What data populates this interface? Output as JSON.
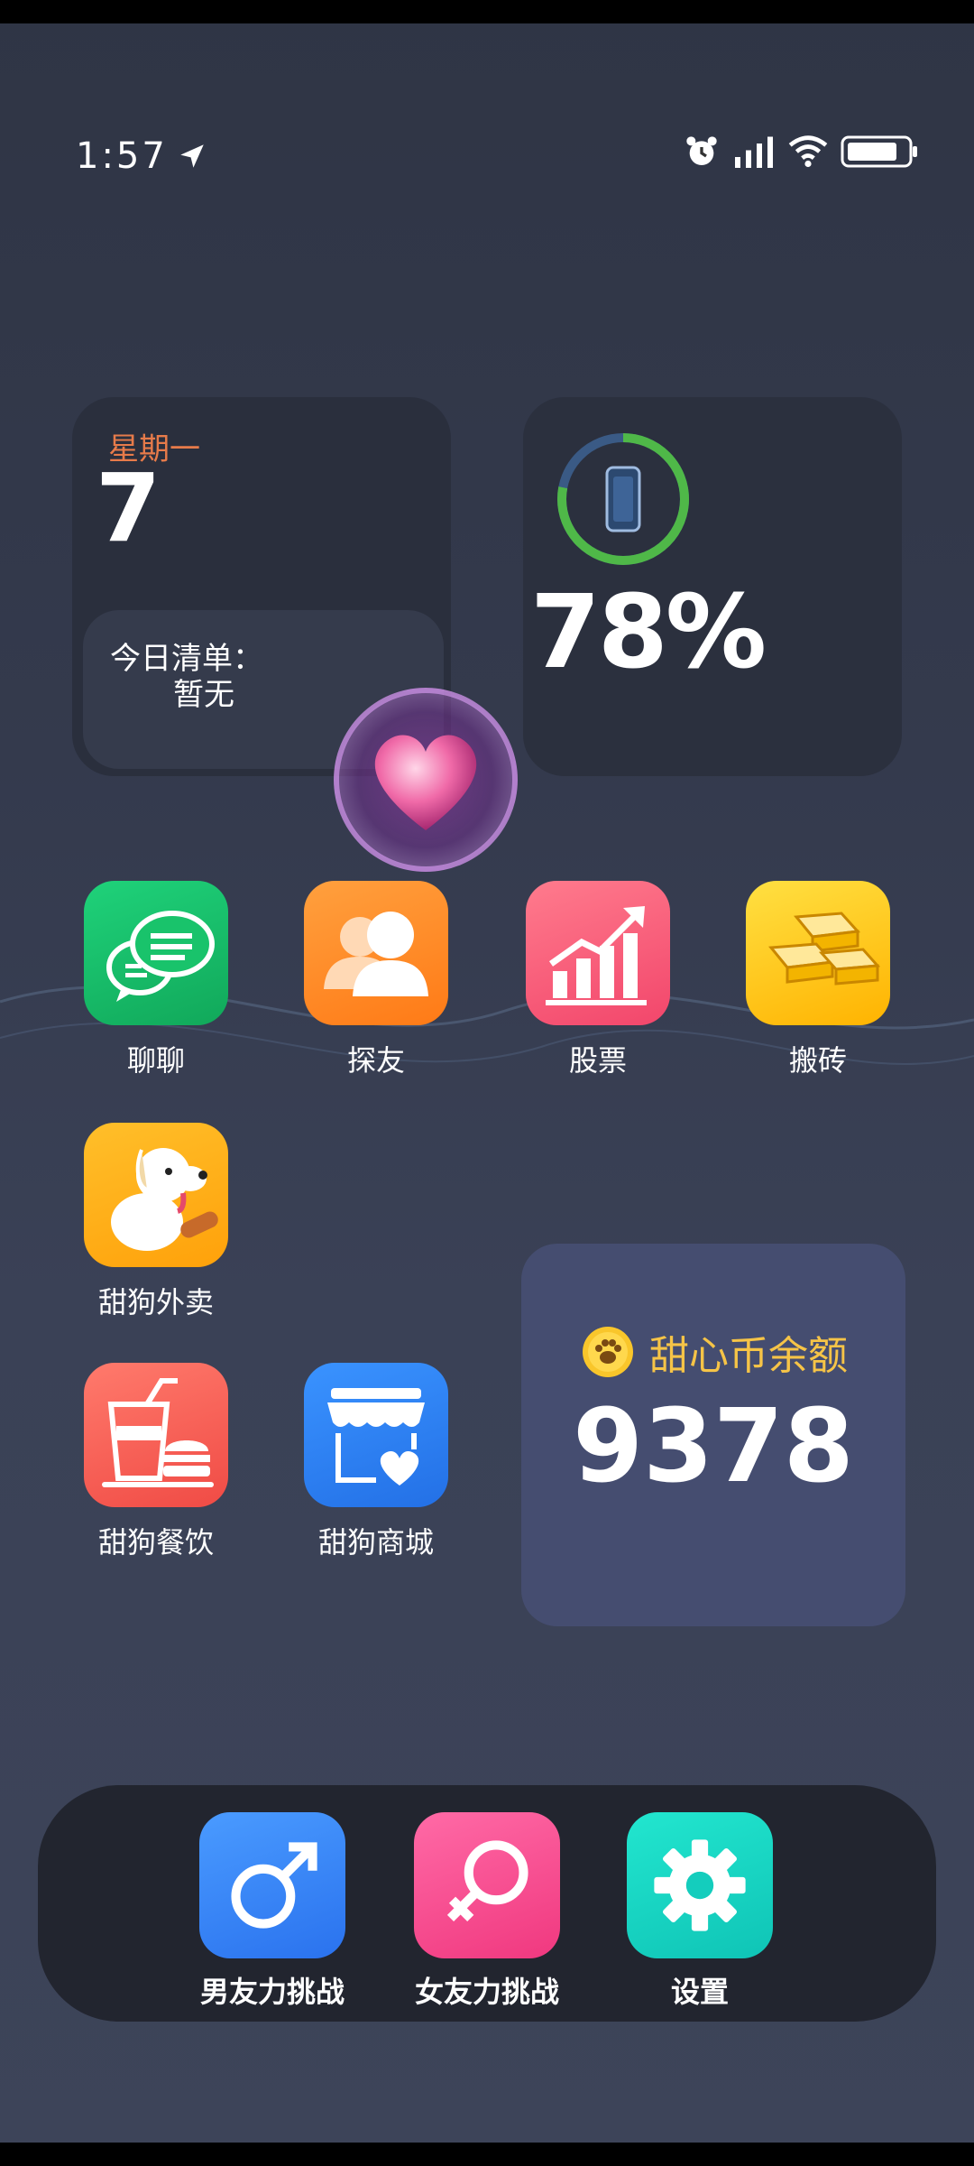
{
  "status_bar": {
    "time": "1:57"
  },
  "date_widget": {
    "weekday": "星期一",
    "day": "7",
    "todo_title": "今日清单：",
    "todo_value": "暂无"
  },
  "battery_widget": {
    "percent_text": "78%",
    "level": 0.78
  },
  "coin_widget": {
    "label": "甜心币余额",
    "value": "9378"
  },
  "apps": [
    {
      "label": "聊聊",
      "icon": "chat-icon",
      "color": "#19c36b"
    },
    {
      "label": "探友",
      "icon": "friends-icon",
      "color": "#ff8a2a"
    },
    {
      "label": "股票",
      "icon": "stock-chart-icon",
      "color": "#ff5f7a"
    },
    {
      "label": "搬砖",
      "icon": "gold-bars-icon",
      "color": "#ffc619"
    },
    {
      "label": "甜狗外卖",
      "icon": "dog-icon",
      "color": "#ffae10"
    },
    {
      "label": "甜狗餐饮",
      "icon": "food-icon",
      "color": "#ff5c55"
    },
    {
      "label": "甜狗商城",
      "icon": "store-icon",
      "color": "#2f82f2"
    }
  ],
  "dock": [
    {
      "label": "男友力挑战",
      "icon": "male-symbol-icon",
      "color": "#3c8cff"
    },
    {
      "label": "女友力挑战",
      "icon": "female-symbol-icon",
      "color": "#ff4a8f"
    },
    {
      "label": "设置",
      "icon": "gear-icon",
      "color": "#17d8c2"
    }
  ],
  "floating": {
    "icon": "heart-icon"
  }
}
